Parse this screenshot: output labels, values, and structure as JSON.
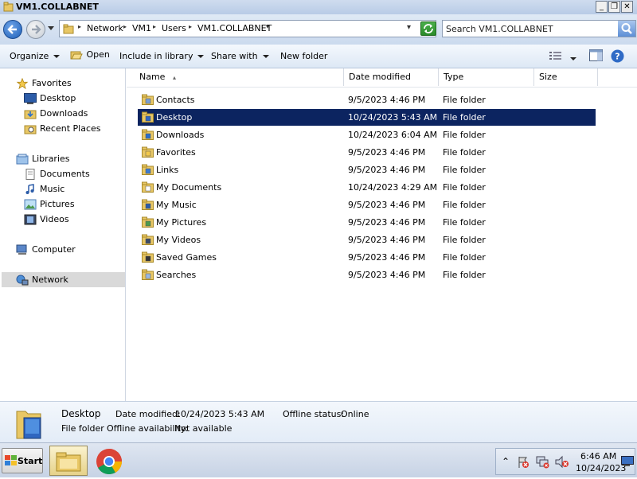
{
  "window": {
    "title": "VM1.COLLABNET",
    "min_glyph": "_",
    "max_glyph": "❐",
    "close_glyph": "✕"
  },
  "address": {
    "crumbs": [
      "Network",
      "VM1",
      "Users",
      "VM1.COLLABNET"
    ],
    "search_placeholder": "Search VM1.COLLABNET"
  },
  "toolbar": {
    "organize": "Organize",
    "open": "Open",
    "include_in_library": "Include in library",
    "share_with": "Share with",
    "new_folder": "New folder"
  },
  "sidebar": {
    "favorites": {
      "label": "Favorites",
      "items": [
        "Desktop",
        "Downloads",
        "Recent Places"
      ]
    },
    "libraries": {
      "label": "Libraries",
      "items": [
        "Documents",
        "Music",
        "Pictures",
        "Videos"
      ]
    },
    "computer": "Computer",
    "network": "Network"
  },
  "columns": {
    "name": "Name",
    "date": "Date modified",
    "type": "Type",
    "size": "Size"
  },
  "files": [
    {
      "name": "Contacts",
      "date": "9/5/2023 4:46 PM",
      "type": "File folder",
      "icon": "contacts-folder-icon"
    },
    {
      "name": "Desktop",
      "date": "10/24/2023 5:43 AM",
      "type": "File folder",
      "icon": "desktop-folder-icon",
      "selected": true
    },
    {
      "name": "Downloads",
      "date": "10/24/2023 6:04 AM",
      "type": "File folder",
      "icon": "downloads-folder-icon"
    },
    {
      "name": "Favorites",
      "date": "9/5/2023 4:46 PM",
      "type": "File folder",
      "icon": "favorites-folder-icon"
    },
    {
      "name": "Links",
      "date": "9/5/2023 4:46 PM",
      "type": "File folder",
      "icon": "links-folder-icon"
    },
    {
      "name": "My Documents",
      "date": "10/24/2023 4:29 AM",
      "type": "File folder",
      "icon": "documents-folder-icon"
    },
    {
      "name": "My Music",
      "date": "9/5/2023 4:46 PM",
      "type": "File folder",
      "icon": "music-folder-icon"
    },
    {
      "name": "My Pictures",
      "date": "9/5/2023 4:46 PM",
      "type": "File folder",
      "icon": "pictures-folder-icon"
    },
    {
      "name": "My Videos",
      "date": "9/5/2023 4:46 PM",
      "type": "File folder",
      "icon": "videos-folder-icon"
    },
    {
      "name": "Saved Games",
      "date": "9/5/2023 4:46 PM",
      "type": "File folder",
      "icon": "saved-games-folder-icon"
    },
    {
      "name": "Searches",
      "date": "9/5/2023 4:46 PM",
      "type": "File folder",
      "icon": "searches-folder-icon"
    }
  ],
  "details": {
    "name": "Desktop",
    "kind": "File folder",
    "date_label": "Date modified:",
    "date_value": "10/24/2023 5:43 AM",
    "offline_status_label": "Offline status:",
    "offline_status_value": "Online",
    "offline_avail_label": "Offline availability:",
    "offline_avail_value": "Not available"
  },
  "taskbar": {
    "start": "Start",
    "time": "6:46 AM",
    "date": "10/24/2023",
    "tray_expand": "⌃"
  },
  "colors": {
    "selection": "#0c2460",
    "title_bar": "#cfdcef",
    "folder": "#e8c765"
  }
}
